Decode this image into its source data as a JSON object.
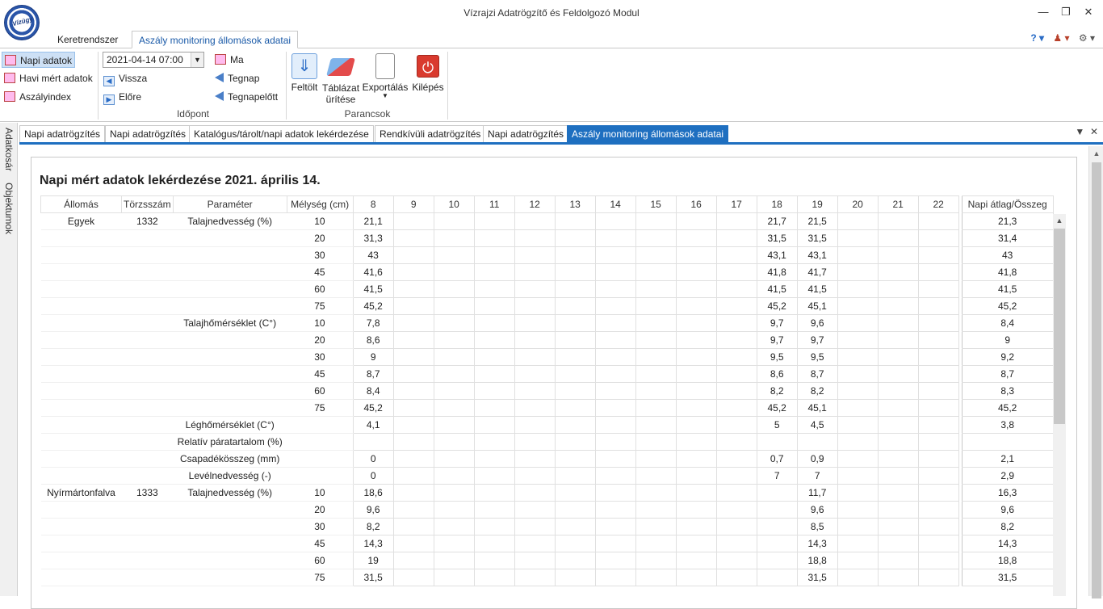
{
  "window": {
    "title": "Vízrajzi Adatrögzítő és Feldolgozó Modul",
    "logo_text": "Vízügy"
  },
  "ribbon_tabs": [
    "Keretrendszer",
    "Aszály monitoring állomások adatai"
  ],
  "ribbon": {
    "nav_items": [
      "Napi adatok",
      "Havi mért adatok",
      "Aszályindex"
    ],
    "date_value": "2021-04-14 07:00",
    "back_label": "Vissza",
    "forward_label": "Előre",
    "day_items": [
      "Ma",
      "Tegnap",
      "Tegnapelőtt"
    ],
    "group_idopont": "Időpont",
    "commands": [
      "Feltölt",
      "Táblázat\nürítése",
      "Exportálás",
      "Kilépés"
    ],
    "command_table_line1": "Táblázat",
    "command_table_line2": "ürítése",
    "group_parancsok": "Parancsok"
  },
  "side_tabs": [
    "Adatkosár",
    "Objektumok"
  ],
  "doc_tabs": [
    "Napi adatrögzítés",
    "Napi adatrögzítés",
    "Katalógus/tárolt/napi adatok lekérdezése",
    "Rendkívüli adatrögzítés",
    "Napi adatrögzítés",
    "Aszály monitoring állomások adatai"
  ],
  "report_title": "Napi mért adatok lekérdezése 2021. április 14.",
  "table": {
    "headers": [
      "Állomás",
      "Törzsszám",
      "Paraméter",
      "Mélység (cm)",
      "8",
      "9",
      "10",
      "11",
      "12",
      "13",
      "14",
      "15",
      "16",
      "17",
      "18",
      "19",
      "20",
      "21",
      "22",
      "Napi átlag/Összeg"
    ],
    "rows": [
      [
        "Egyek",
        "1332",
        "Talajnedvesség (%)",
        "10",
        "21,1",
        "",
        "",
        "",
        "",
        "",
        "",
        "",
        "",
        "",
        "21,7",
        "21,5",
        "",
        "",
        "",
        "21,3"
      ],
      [
        "",
        "",
        "",
        "20",
        "31,3",
        "",
        "",
        "",
        "",
        "",
        "",
        "",
        "",
        "",
        "31,5",
        "31,5",
        "",
        "",
        "",
        "31,4"
      ],
      [
        "",
        "",
        "",
        "30",
        "43",
        "",
        "",
        "",
        "",
        "",
        "",
        "",
        "",
        "",
        "43,1",
        "43,1",
        "",
        "",
        "",
        "43"
      ],
      [
        "",
        "",
        "",
        "45",
        "41,6",
        "",
        "",
        "",
        "",
        "",
        "",
        "",
        "",
        "",
        "41,8",
        "41,7",
        "",
        "",
        "",
        "41,8"
      ],
      [
        "",
        "",
        "",
        "60",
        "41,5",
        "",
        "",
        "",
        "",
        "",
        "",
        "",
        "",
        "",
        "41,5",
        "41,5",
        "",
        "",
        "",
        "41,5"
      ],
      [
        "",
        "",
        "",
        "75",
        "45,2",
        "",
        "",
        "",
        "",
        "",
        "",
        "",
        "",
        "",
        "45,2",
        "45,1",
        "",
        "",
        "",
        "45,2"
      ],
      [
        "",
        "",
        "Talajhőmérséklet (C°)",
        "10",
        "7,8",
        "",
        "",
        "",
        "",
        "",
        "",
        "",
        "",
        "",
        "9,7",
        "9,6",
        "",
        "",
        "",
        "8,4"
      ],
      [
        "",
        "",
        "",
        "20",
        "8,6",
        "",
        "",
        "",
        "",
        "",
        "",
        "",
        "",
        "",
        "9,7",
        "9,7",
        "",
        "",
        "",
        "9"
      ],
      [
        "",
        "",
        "",
        "30",
        "9",
        "",
        "",
        "",
        "",
        "",
        "",
        "",
        "",
        "",
        "9,5",
        "9,5",
        "",
        "",
        "",
        "9,2"
      ],
      [
        "",
        "",
        "",
        "45",
        "8,7",
        "",
        "",
        "",
        "",
        "",
        "",
        "",
        "",
        "",
        "8,6",
        "8,7",
        "",
        "",
        "",
        "8,7"
      ],
      [
        "",
        "",
        "",
        "60",
        "8,4",
        "",
        "",
        "",
        "",
        "",
        "",
        "",
        "",
        "",
        "8,2",
        "8,2",
        "",
        "",
        "",
        "8,3"
      ],
      [
        "",
        "",
        "",
        "75",
        "45,2",
        "",
        "",
        "",
        "",
        "",
        "",
        "",
        "",
        "",
        "45,2",
        "45,1",
        "",
        "",
        "",
        "45,2"
      ],
      [
        "",
        "",
        "Léghőmérséklet (C°)",
        "",
        "4,1",
        "",
        "",
        "",
        "",
        "",
        "",
        "",
        "",
        "",
        "5",
        "4,5",
        "",
        "",
        "",
        "3,8"
      ],
      [
        "",
        "",
        "Relatív páratartalom (%)",
        "",
        "",
        "",
        "",
        "",
        "",
        "",
        "",
        "",
        "",
        "",
        "",
        "",
        "",
        "",
        "",
        ""
      ],
      [
        "",
        "",
        "Csapadékösszeg (mm)",
        "",
        "0",
        "",
        "",
        "",
        "",
        "",
        "",
        "",
        "",
        "",
        "0,7",
        "0,9",
        "",
        "",
        "",
        "2,1"
      ],
      [
        "",
        "",
        "Levélnedvesség (-)",
        "",
        "0",
        "",
        "",
        "",
        "",
        "",
        "",
        "",
        "",
        "",
        "7",
        "7",
        "",
        "",
        "",
        "2,9"
      ],
      [
        "Nyírmártonfalva",
        "1333",
        "Talajnedvesség (%)",
        "10",
        "18,6",
        "",
        "",
        "",
        "",
        "",
        "",
        "",
        "",
        "",
        "",
        "11,7",
        "",
        "",
        "",
        "16,3"
      ],
      [
        "",
        "",
        "",
        "20",
        "9,6",
        "",
        "",
        "",
        "",
        "",
        "",
        "",
        "",
        "",
        "",
        "9,6",
        "",
        "",
        "",
        "9,6"
      ],
      [
        "",
        "",
        "",
        "30",
        "8,2",
        "",
        "",
        "",
        "",
        "",
        "",
        "",
        "",
        "",
        "",
        "8,5",
        "",
        "",
        "",
        "8,2"
      ],
      [
        "",
        "",
        "",
        "45",
        "14,3",
        "",
        "",
        "",
        "",
        "",
        "",
        "",
        "",
        "",
        "",
        "14,3",
        "",
        "",
        "",
        "14,3"
      ],
      [
        "",
        "",
        "",
        "60",
        "19",
        "",
        "",
        "",
        "",
        "",
        "",
        "",
        "",
        "",
        "",
        "18,8",
        "",
        "",
        "",
        "18,8"
      ],
      [
        "",
        "",
        "",
        "75",
        "31,5",
        "",
        "",
        "",
        "",
        "",
        "",
        "",
        "",
        "",
        "",
        "31,5",
        "",
        "",
        "",
        "31,5"
      ]
    ]
  }
}
